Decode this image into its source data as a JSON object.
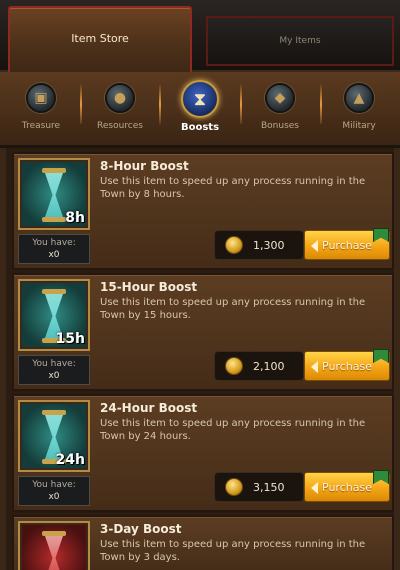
{
  "tabs": {
    "item_store": "Item Store",
    "my_items": "My Items"
  },
  "categories": [
    {
      "label": "Treasure",
      "icon": "treasure-chest-icon"
    },
    {
      "label": "Resources",
      "icon": "resources-sack-icon"
    },
    {
      "label": "Boosts",
      "icon": "hourglass-icon",
      "active": true
    },
    {
      "label": "Bonuses",
      "icon": "bonuses-icon"
    },
    {
      "label": "Military",
      "icon": "military-helmet-icon"
    }
  ],
  "have_label": "You have:",
  "purchase_label": "Purchase",
  "items": [
    {
      "title": "8-Hour Boost",
      "desc": "Use this item to speed up any process running in the Town by 8 hours.",
      "badge": "8h",
      "count": "x0",
      "price": "1,300"
    },
    {
      "title": "15-Hour Boost",
      "desc": "Use this item to speed up any process running in the Town by 15 hours.",
      "badge": "15h",
      "count": "x0",
      "price": "2,100"
    },
    {
      "title": "24-Hour Boost",
      "desc": "Use this item to speed up any process running in the Town by 24 hours.",
      "badge": "24h",
      "count": "x0",
      "price": "3,150"
    },
    {
      "title": "3-Day Boost",
      "desc": "Use this item to speed up any process running in the Town by 3 days."
    }
  ],
  "colors": {
    "accent_gold": "#f5a516",
    "active_tab_border": "#8e2a20",
    "panel_brown": "#4e331c"
  }
}
